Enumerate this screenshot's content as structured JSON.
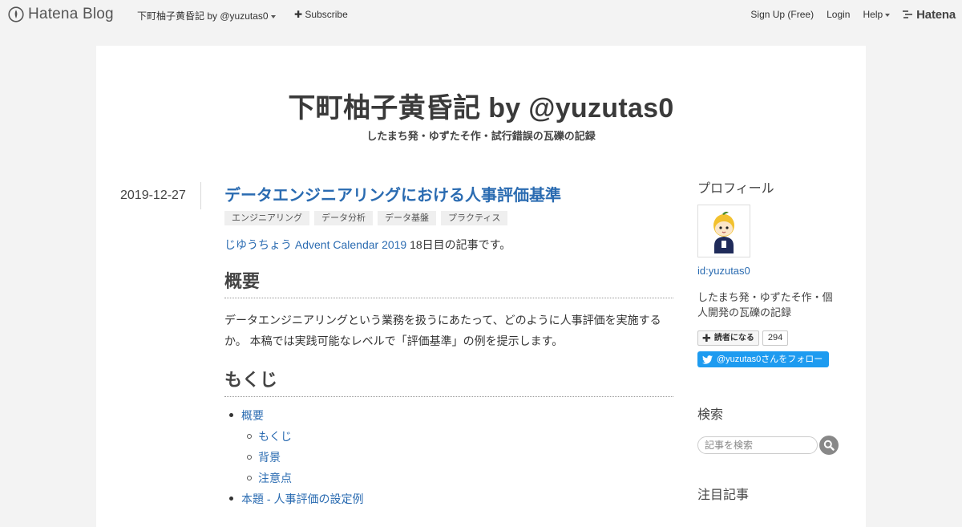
{
  "header": {
    "logo_text": "Hatena Blog",
    "blog_name": "下町柚子黄昏記 by @yuzutas0",
    "subscribe": "Subscribe",
    "signup": "Sign Up (Free)",
    "login": "Login",
    "help": "Help",
    "brand": "Hatena"
  },
  "blog": {
    "title": "下町柚子黄昏記 by @yuzutas0",
    "description": "したまち発・ゆずたそ作・試行錯誤の瓦礫の記録"
  },
  "entry": {
    "date": "2019-12-27",
    "title": "データエンジニアリングにおける人事評価基準",
    "tags": [
      "エンジニアリング",
      "データ分析",
      "データ基盤",
      "プラクティス"
    ],
    "intro_link": "じゆうちょう Advent Calendar 2019",
    "intro_rest": " 18日目の記事です。",
    "heading_summary": "概要",
    "summary_text": "データエンジニアリングという業務を扱うにあたって、どのように人事評価を実施するか。 本稿では実践可能なレベルで「評価基準」の例を提示します。",
    "heading_toc": "もくじ",
    "toc": [
      {
        "label": "概要",
        "level": 1
      },
      {
        "label": "もくじ",
        "level": 2
      },
      {
        "label": "背景",
        "level": 2
      },
      {
        "label": "注意点",
        "level": 2
      },
      {
        "label": "本題 - 人事評価の設定例",
        "level": 1
      }
    ]
  },
  "sidebar": {
    "profile_title": "プロフィール",
    "profile_id": "id:yuzutas0",
    "profile_desc": "したまち発・ゆずたそ作・個人開発の瓦礫の記録",
    "follow_label": "読者になる",
    "follow_count": "294",
    "twitter_label": "@yuzutas0さんをフォロー",
    "search_title": "検索",
    "search_placeholder": "記事を検索",
    "featured_title": "注目記事"
  },
  "colors": {
    "link": "#2a6bb1",
    "twitter": "#1d9bf0",
    "page_bg": "#f3f3f3"
  }
}
